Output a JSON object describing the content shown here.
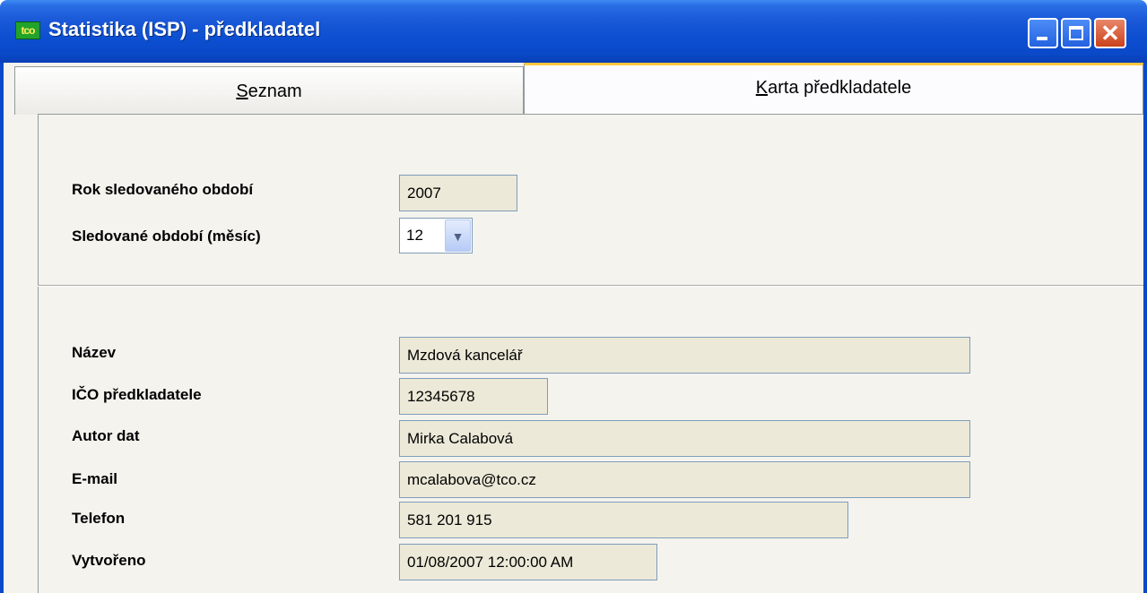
{
  "window": {
    "title": "Statistika (ISP) - předkladatel",
    "app_icon_text": "tco",
    "controls": {
      "minimize": "minimize-icon",
      "maximize": "maximize-icon",
      "close": "close-icon"
    }
  },
  "tabs": [
    {
      "label_prefix": "",
      "mnemonic": "S",
      "label_rest": "eznam",
      "selected": false
    },
    {
      "label_prefix": "",
      "mnemonic": "K",
      "label_rest": "arta předkladatele",
      "selected": true
    }
  ],
  "period": {
    "year_label": "Rok sledovaného období",
    "year_value": "2007",
    "month_label": "Sledované období (měsíc)",
    "month_value": "12"
  },
  "submitter": {
    "name_label": "Název",
    "name_value": "Mzdová kancelář",
    "ico_label": "IČO předkladatele",
    "ico_value": "12345678",
    "author_label": "Autor dat",
    "author_value": "Mirka Calabová",
    "email_label": "E-mail",
    "email_value": "mcalabova@tco.cz",
    "phone_label": "Telefon",
    "phone_value": "581 201 915",
    "created_label": "Vytvořeno",
    "created_value": "01/08/2007 12:00:00 AM"
  },
  "colors": {
    "titlebar": "#0a49c9",
    "field_bg": "#ece9d8",
    "tab_highlight": "#ffc83c"
  }
}
